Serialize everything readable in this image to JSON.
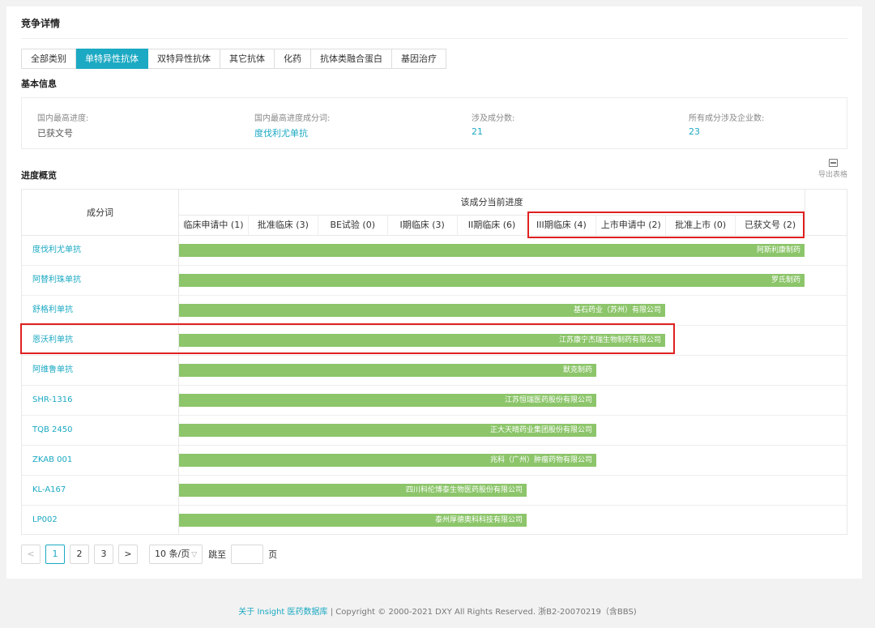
{
  "page": {
    "title": "竞争详情"
  },
  "tabs": [
    "全部类别",
    "单特异性抗体",
    "双特异性抗体",
    "其它抗体",
    "化药",
    "抗体类融合蛋白",
    "基因治疗"
  ],
  "basic": {
    "title": "基本信息",
    "items": [
      {
        "label": "国内最高进度:",
        "value": "已获文号"
      },
      {
        "label": "国内最高进度成分词:",
        "value": "度伐利尤单抗"
      },
      {
        "label": "涉及成分数:",
        "value": "21"
      },
      {
        "label": "所有成分涉及企业数:",
        "value": "23"
      }
    ]
  },
  "progress": {
    "title": "进度概览",
    "export_label": "导出表格",
    "name_header": "成分词",
    "stage_header": "该成分当前进度",
    "stages": [
      "临床申请中 (1)",
      "批准临床 (3)",
      "BE试验 (0)",
      "I期临床 (3)",
      "II期临床 (6)",
      "III期临床 (4)",
      "上市申请中 (2)",
      "批准上市 (0)",
      "已获文号 (2)"
    ],
    "extra_header": ":",
    "rows": [
      {
        "name": "度伐利尤单抗",
        "company": "阿斯利康制药",
        "stage_index": 8,
        "dot": "("
      },
      {
        "name": "阿替利珠单抗",
        "company": "罗氏制药",
        "stage_index": 8,
        "dot": "("
      },
      {
        "name": "舒格利单抗",
        "company": "基石药业（苏州）有限公司",
        "stage_index": 6,
        "dot": "("
      },
      {
        "name": "恩沃利单抗",
        "company": "江苏康宁杰瑞生物制药有限公司",
        "stage_index": 6,
        "dot": "("
      },
      {
        "name": "阿维鲁单抗",
        "company": "默克制药",
        "stage_index": 5,
        "dot": "("
      },
      {
        "name": "SHR-1316",
        "company": "江苏恒瑞医药股份有限公司",
        "stage_index": 5,
        "dot": "("
      },
      {
        "name": "TQB 2450",
        "company": "正大天晴药业集团股份有限公司",
        "stage_index": 5,
        "dot": "("
      },
      {
        "name": "ZKAB 001",
        "company": "兆科（广州）肿瘤药物有限公司",
        "stage_index": 5,
        "dot": "("
      },
      {
        "name": "KL-A167",
        "company": "四川科伦博泰生物医药股份有限公司",
        "stage_index": 4,
        "dot": "("
      },
      {
        "name": "LP002",
        "company": "泰州厚德奥科科技有限公司",
        "stage_index": 4,
        "dot": "("
      }
    ]
  },
  "pagination": {
    "prev": "<",
    "pages": [
      "1",
      "2",
      "3"
    ],
    "current": "1",
    "next": ">",
    "page_size": "10 条/页",
    "jump_label": "跳至",
    "page_unit": "页"
  },
  "footer": {
    "link": "关于 Insight 医药数据库",
    "text": " | Copyright © 2000-2021 DXY All Rights Reserved. 浙B2-20070219（含BBS)"
  },
  "colors": {
    "accent": "#1ba9c3",
    "bar": "#8cc56a",
    "highlight": "#e02020"
  }
}
